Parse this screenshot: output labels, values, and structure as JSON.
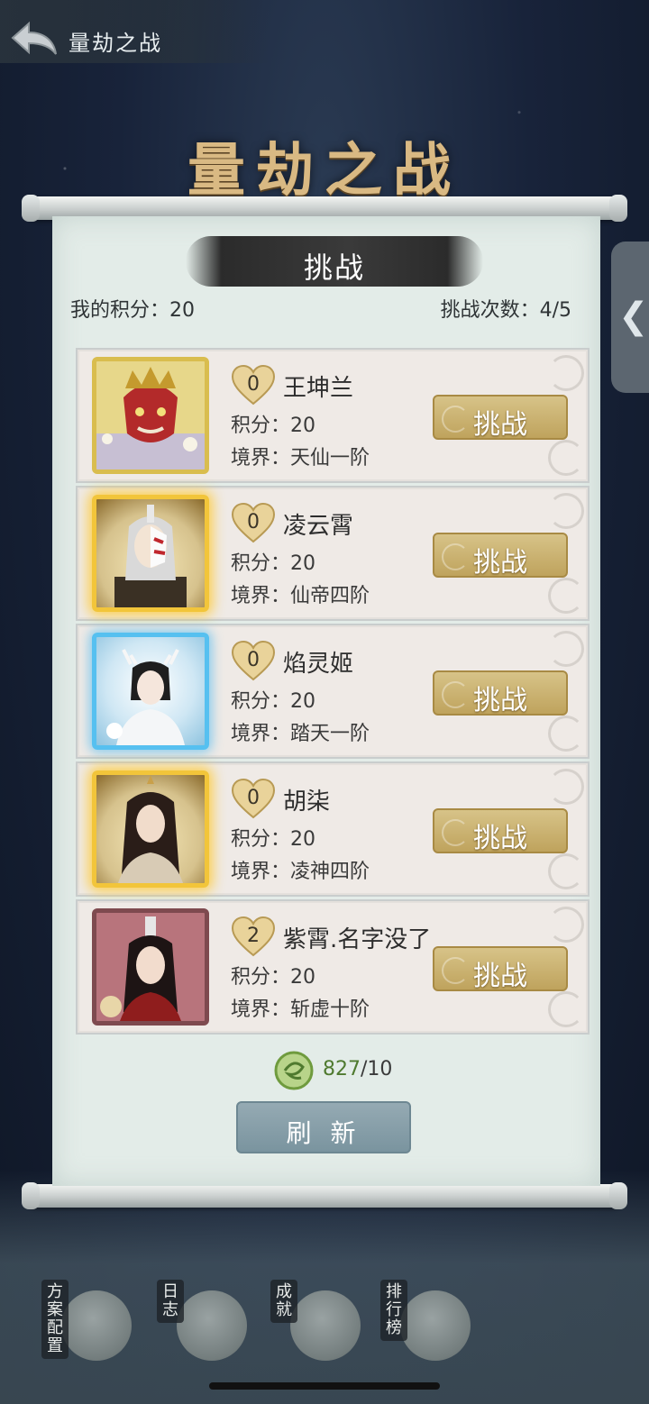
{
  "header": {
    "back_label": "back",
    "title": "量劫之战"
  },
  "banner_title": "量劫之战",
  "panel": {
    "tab_title": "挑战",
    "my_score_label": "我的积分：20",
    "attempts_label": "挑战次数：4/5"
  },
  "opponents": [
    {
      "hearts": "0",
      "name": "王坤兰",
      "score": "积分：20",
      "realm": "境界：天仙一阶",
      "button": "挑战"
    },
    {
      "hearts": "0",
      "name": "凌云霄",
      "score": "积分：20",
      "realm": "境界：仙帝四阶",
      "button": "挑战"
    },
    {
      "hearts": "0",
      "name": "焰灵姬",
      "score": "积分：20",
      "realm": "境界：踏天一阶",
      "button": "挑战"
    },
    {
      "hearts": "0",
      "name": "胡柒",
      "score": "积分：20",
      "realm": "境界：凌神四阶",
      "button": "挑战"
    },
    {
      "hearts": "2",
      "name": "紫霄.名字没了",
      "score": "积分：20",
      "realm": "境界：斩虚十阶",
      "button": "挑战"
    }
  ],
  "currency": {
    "owned": "827",
    "cost": "/10"
  },
  "refresh_label": "刷 新",
  "side_tab_glyph": "❮",
  "bottom_nav": [
    {
      "label": "方案配置",
      "icon": "scroll-brush-icon"
    },
    {
      "label": "日志",
      "icon": "scroll-icon"
    },
    {
      "label": "成就",
      "icon": "rolled-scroll-icon"
    },
    {
      "label": "排行榜",
      "icon": "bar-chart-icon"
    }
  ],
  "colors": {
    "accent_gold": "#bfa35d",
    "refresh_blue": "#7a949f",
    "currency_green": "#4f7a2f"
  }
}
